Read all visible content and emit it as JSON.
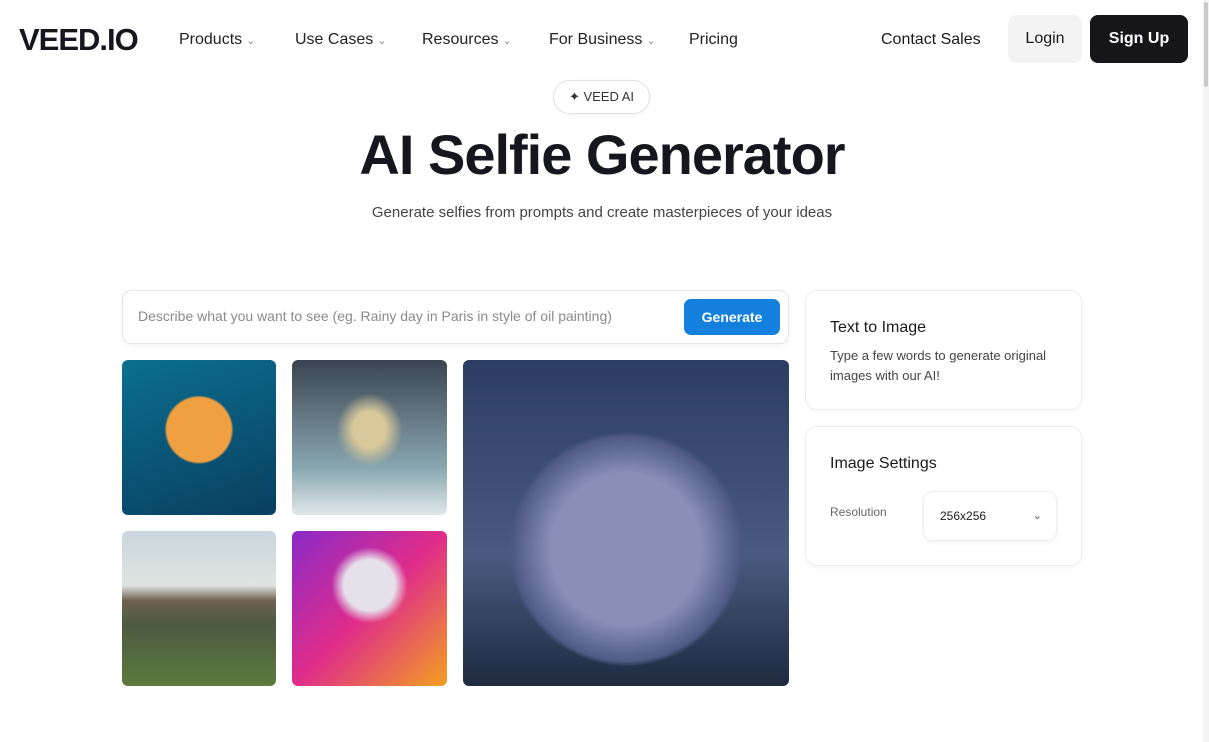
{
  "nav": {
    "logo": "VEED.IO",
    "items": [
      {
        "label": "Products"
      },
      {
        "label": "Use Cases"
      },
      {
        "label": "Resources"
      },
      {
        "label": "For Business"
      },
      {
        "label": "Pricing"
      }
    ],
    "contact": "Contact Sales",
    "login": "Login",
    "signup": "Sign Up"
  },
  "hero": {
    "badge": "VEED AI",
    "title": "AI Selfie Generator",
    "subtitle": "Generate selfies from prompts and create masterpieces of your ideas"
  },
  "prompt": {
    "placeholder": "Describe what you want to see (eg. Rainy day in Paris in style of oil painting)",
    "button": "Generate"
  },
  "text_to_image": {
    "title": "Text to Image",
    "desc": "Type a few words to generate original images with our AI!"
  },
  "settings": {
    "title": "Image Settings",
    "resolution_label": "Resolution",
    "resolution_value": "256x256"
  },
  "colors": {
    "accent": "#1480dd",
    "dark": "#16161a"
  }
}
